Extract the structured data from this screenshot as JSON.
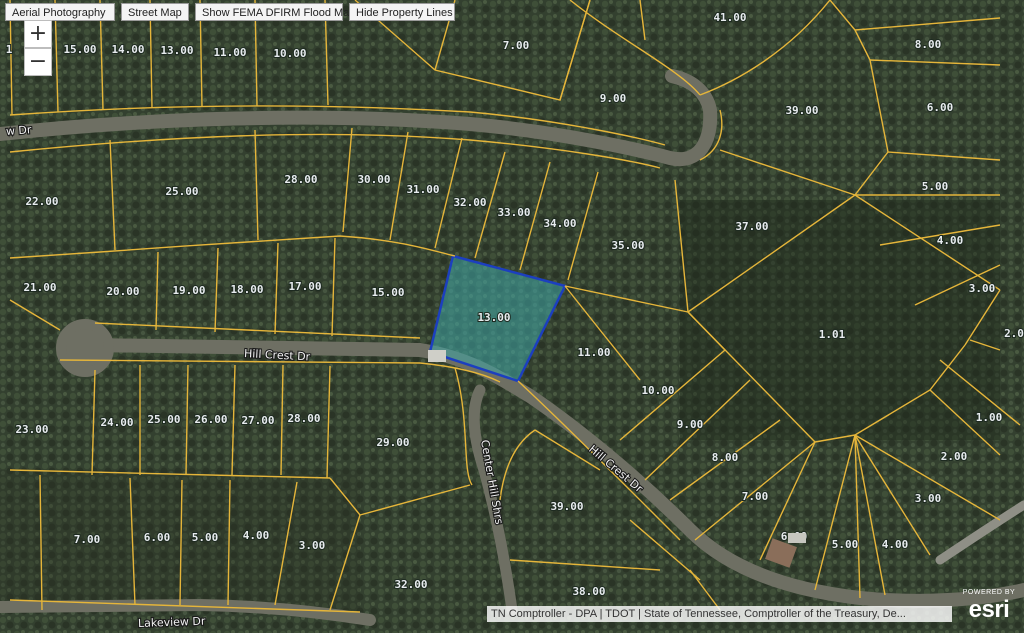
{
  "toolbar": {
    "aerial": "Aerial Photography",
    "street": "Street Map",
    "flood": "Show FEMA DFIRM Flood Map",
    "lines": "Hide Property Lines"
  },
  "zoom": {
    "in": "+",
    "out": "−"
  },
  "parcels": {
    "p15_top": "15.00",
    "p14_top": "14.00",
    "p13_top": "13.00",
    "p11_top": "11.00",
    "p10_top": "10.00",
    "p7_top": "7.00",
    "p9_top": "9.00",
    "p41": "41.00",
    "p8_right": "8.00",
    "p39_top": "39.00",
    "p6_right": "6.00",
    "p22": "22.00",
    "p25": "25.00",
    "p28": "28.00",
    "p30": "30.00",
    "p31": "31.00",
    "p32": "32.00",
    "p33": "33.00",
    "p34": "34.00",
    "p35": "35.00",
    "p37": "37.00",
    "p5_right": "5.00",
    "p4_right": "4.00",
    "p3_right": "3.00",
    "p2_partial": "2.0",
    "p21": "21.00",
    "p20": "20.00",
    "p19": "19.00",
    "p18": "18.00",
    "p17": "17.00",
    "p15_mid": "15.00",
    "p13_sel": "13.00",
    "p11_mid": "11.00",
    "p1_01": "1.01",
    "p10_mid": "10.00",
    "p9_mid": "9.00",
    "p8_mid": "8.00",
    "p7_mid": "7.00",
    "p1_00": "1.00",
    "p2_00": "2.00",
    "p3_00": "3.00",
    "p23": "23.00",
    "p24": "24.00",
    "p25_low": "25.00",
    "p26": "26.00",
    "p27": "27.00",
    "p28_low": "28.00",
    "p29": "29.00",
    "p39_low": "39.00",
    "p6_low": "6.00",
    "p5_low": "5.00",
    "p4_low": "4.00",
    "p7_low": "7.00",
    "p6_bl": "6.00",
    "p5_bl": "5.00",
    "p4_bl": "4.00",
    "p3_bl": "3.00",
    "p32_low": "32.00",
    "p38": "38.00",
    "p_partial_left": "1"
  },
  "roads": {
    "view_dr": "w Dr",
    "hill_crest_1": "Hill Crest Dr",
    "hill_crest_2": "Hill Crest Dr",
    "center_hill": "Center Hill Shrs",
    "lakeview": "Lakeview Dr"
  },
  "attribution": "TN Comptroller - DPA | TDOT | State of Tennessee, Comptroller of the Treasury, De...",
  "logo": {
    "powered": "POWERED BY",
    "brand": "esri"
  },
  "colors": {
    "parcel_line": "#e5b53a",
    "selected_fill": "#3fa7a7",
    "selected_stroke": "#1c3fbf"
  }
}
